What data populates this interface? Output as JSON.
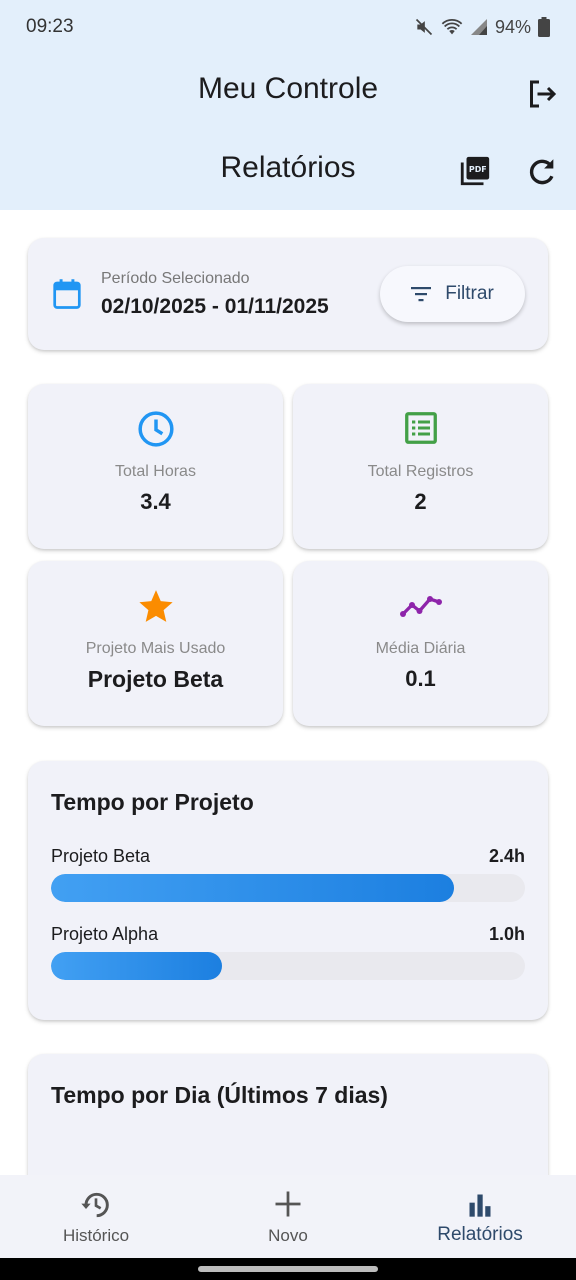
{
  "status_bar": {
    "time": "09:23",
    "battery": "94%"
  },
  "header": {
    "app_title": "Meu Controle",
    "page_title": "Relatórios"
  },
  "period": {
    "label": "Período Selecionado",
    "value": "02/10/2025 - 01/11/2025",
    "filter_label": "Filtrar"
  },
  "stats": [
    {
      "label": "Total Horas",
      "value": "3.4",
      "icon": "clock-icon",
      "color": "#2196f3"
    },
    {
      "label": "Total Registros",
      "value": "2",
      "icon": "list-icon",
      "color": "#43a047"
    },
    {
      "label": "Projeto Mais Usado",
      "value": "Projeto Beta",
      "icon": "star-icon",
      "color": "#fb8c00"
    },
    {
      "label": "Média Diária",
      "value": "0.1",
      "icon": "trend-icon",
      "color": "#8e24aa"
    }
  ],
  "time_by_project": {
    "title": "Tempo por Projeto",
    "projects": [
      {
        "name": "Projeto Beta",
        "hours": "2.4h",
        "fraction": 0.85
      },
      {
        "name": "Projeto Alpha",
        "hours": "1.0h",
        "fraction": 0.36
      }
    ]
  },
  "time_by_day": {
    "title": "Tempo por Dia (Últimos 7 dias)"
  },
  "nav": [
    {
      "label": "Histórico",
      "icon": "history-icon",
      "active": false
    },
    {
      "label": "Novo",
      "icon": "plus-icon",
      "active": false
    },
    {
      "label": "Relatórios",
      "icon": "bar-chart-icon",
      "active": true
    }
  ],
  "colors": {
    "header_bg": "#e3effb",
    "accent": "#2e4a6b",
    "bar": "#1e88e5"
  }
}
